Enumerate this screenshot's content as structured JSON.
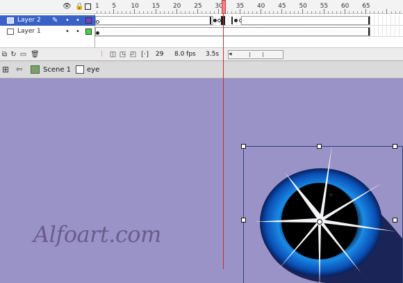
{
  "timeline": {
    "ruler_numbers": [
      "1",
      "5",
      "10",
      "15",
      "20",
      "25",
      "30",
      "35",
      "40",
      "45",
      "50",
      "55",
      "60",
      "65"
    ],
    "header_icons": [
      "eye-icon",
      "lock-icon",
      "outline-icon"
    ],
    "current_frame_marker": "30",
    "layers": [
      {
        "name": "Layer 2",
        "selected": true,
        "color": "#7b3fd6"
      },
      {
        "name": "Layer 1",
        "selected": false,
        "color": "#43d843"
      }
    ],
    "footer": {
      "frame": "29",
      "fps": "8.0 fps",
      "time": "3.5s"
    }
  },
  "editbar": {
    "scene_label": "Scene 1",
    "symbol_label": "eye"
  },
  "stage": {
    "watermark": "Alfoart.com",
    "background": "#9a93c8"
  },
  "colors": {
    "selection": "#3a62c6",
    "playhead": "#c23030"
  }
}
